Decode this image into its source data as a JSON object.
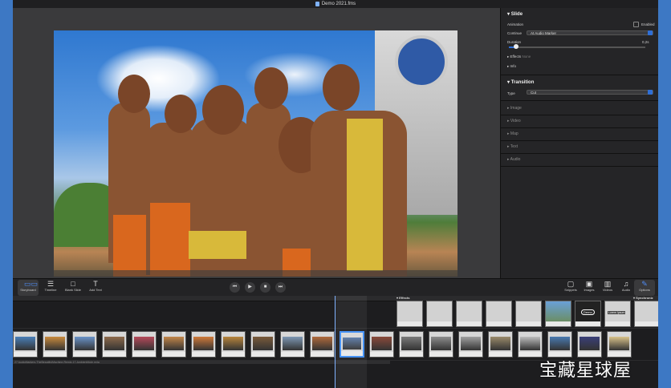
{
  "window": {
    "title": "Demo 2021.fms"
  },
  "inspector": {
    "slide": {
      "header": "Slide",
      "animation_label": "Animation",
      "enabled_label": "Enabled",
      "continue_label": "Continue",
      "continue_value": "At Audio Marker",
      "duration_label": "Duration",
      "duration_value": "0,2s",
      "duration_fraction": 0.05,
      "effects_label": "Effects",
      "effects_value": "None",
      "info_label": "Info"
    },
    "transition": {
      "header": "Transition",
      "type_label": "Type",
      "type_value": "Cut"
    },
    "collapsed_sections": [
      "Image",
      "Video",
      "Map",
      "Text",
      "Audio"
    ]
  },
  "toolbar": {
    "left": [
      {
        "label": "Storyboard",
        "icon": "storyboard-icon",
        "glyph": "▭▭",
        "active": true
      },
      {
        "label": "Timeline",
        "icon": "timeline-icon",
        "glyph": "☰",
        "active": false
      },
      {
        "label": "Blank Slide",
        "icon": "blank-slide-icon",
        "glyph": "□",
        "active": false
      },
      {
        "label": "Add Text",
        "icon": "add-text-icon",
        "glyph": "T",
        "active": false
      }
    ],
    "transport": [
      {
        "name": "rewind",
        "glyph": "⏮"
      },
      {
        "name": "play",
        "glyph": "▶"
      },
      {
        "name": "stop",
        "glyph": "■"
      },
      {
        "name": "forward",
        "glyph": "⏭"
      }
    ],
    "right": [
      {
        "label": "Snippets",
        "icon": "snippets-icon",
        "glyph": "▢",
        "active": false
      },
      {
        "label": "Images",
        "icon": "images-icon",
        "glyph": "▣",
        "active": false
      },
      {
        "label": "Videos",
        "icon": "videos-icon",
        "glyph": "▥",
        "active": false
      },
      {
        "label": "Audio",
        "icon": "audio-icon",
        "glyph": "♫",
        "active": false
      },
      {
        "label": "Options",
        "icon": "options-icon",
        "glyph": "✎",
        "active": true
      }
    ]
  },
  "timeline": {
    "effects_label": "Effects",
    "sync_label": "Synchroniz",
    "audio_file": "27 AudioMarkers-TheBeautifulMachine-Remix-17-AmbientMole.m4a",
    "card_text": "Demo",
    "title_card_text": "Lorem Ipsum"
  },
  "watermark": "宝藏星球屋",
  "colors": {
    "accent": "#3b8cf5",
    "background": "#2a2a2c",
    "desktop": "#3d78c4"
  }
}
